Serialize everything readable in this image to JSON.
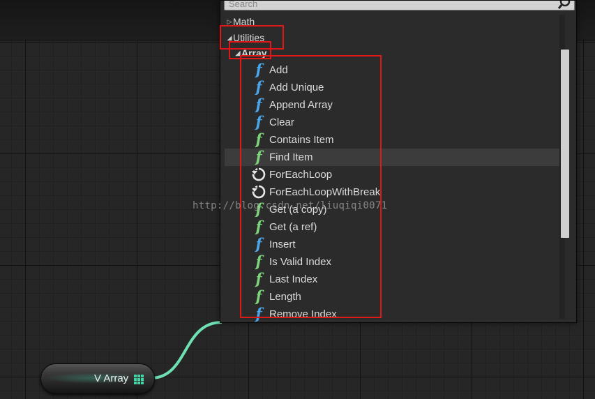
{
  "search": {
    "placeholder": "Search"
  },
  "categories": {
    "math": "Math",
    "utilities": "Utilities",
    "array": "Array"
  },
  "items": [
    {
      "label": "Add",
      "icon": "function-icon",
      "color": "#4aa6e8"
    },
    {
      "label": "Add Unique",
      "icon": "function-icon",
      "color": "#4aa6e8"
    },
    {
      "label": "Append Array",
      "icon": "function-icon",
      "color": "#4aa6e8"
    },
    {
      "label": "Clear",
      "icon": "function-icon",
      "color": "#4aa6e8"
    },
    {
      "label": "Contains Item",
      "icon": "function-icon",
      "color": "#7dd37a"
    },
    {
      "label": "Find Item",
      "icon": "function-icon",
      "color": "#7dd37a"
    },
    {
      "label": "ForEachLoop",
      "icon": "macro-icon",
      "color": "#e8e8e8"
    },
    {
      "label": "ForEachLoopWithBreak",
      "icon": "macro-icon",
      "color": "#e8e8e8"
    },
    {
      "label": "Get (a copy)",
      "icon": "function-icon",
      "color": "#7dd37a"
    },
    {
      "label": "Get (a ref)",
      "icon": "function-icon",
      "color": "#7dd37a"
    },
    {
      "label": "Insert",
      "icon": "function-icon",
      "color": "#4aa6e8"
    },
    {
      "label": "Is Valid Index",
      "icon": "function-icon",
      "color": "#7dd37a"
    },
    {
      "label": "Last Index",
      "icon": "function-icon",
      "color": "#7dd37a"
    },
    {
      "label": "Length",
      "icon": "function-icon",
      "color": "#7dd37a"
    },
    {
      "label": "Remove Index",
      "icon": "function-icon",
      "color": "#4aa6e8"
    }
  ],
  "watermark": "http://blog.csdn.net/liuqiqi0071",
  "node": {
    "label": "V Array",
    "pin_color": "#3fd7a8",
    "wire_color": "#6ee0b4"
  }
}
